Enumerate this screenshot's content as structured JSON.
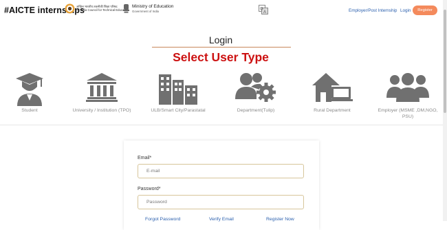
{
  "header": {
    "brand": "#AICTE internships",
    "logo_aicte_lines": [
      "अखिल भारतीय तकनीकी शिक्षा परिषद",
      "All India Council for Technical Education"
    ],
    "logo_moe_title": "Ministry of Education",
    "logo_moe_sub": "Government of India",
    "nav_employer": "Employer/Post Internship",
    "nav_login": "Login",
    "nav_register": "Register"
  },
  "page": {
    "login_title": "Login",
    "select_title": "Select User Type"
  },
  "user_types": [
    {
      "label": "Student",
      "icon": "student-icon"
    },
    {
      "label": "University / Institution (TPO)",
      "icon": "university-icon"
    },
    {
      "label": "ULB/Smart City/Parastatal",
      "icon": "city-buildings-icon"
    },
    {
      "label": "Department(Tulip)",
      "icon": "department-users-gear-icon"
    },
    {
      "label": "Rural Department",
      "icon": "rural-house-icon"
    },
    {
      "label": "Employer (MSME ,DM,NGO, PSU)",
      "icon": "employer-group-icon"
    }
  ],
  "form": {
    "email_label": "Email*",
    "email_placeholder": "E-mail",
    "password_label": "Password*",
    "password_placeholder": "Password",
    "forgot_password": "Forgot Password",
    "verify_email": "Verify Email",
    "register_now": "Register Now"
  },
  "colors": {
    "accent_orange": "#f48a5c",
    "title_red": "#cc1111",
    "link_blue": "#2a5fad",
    "icon_gray": "#707070"
  }
}
